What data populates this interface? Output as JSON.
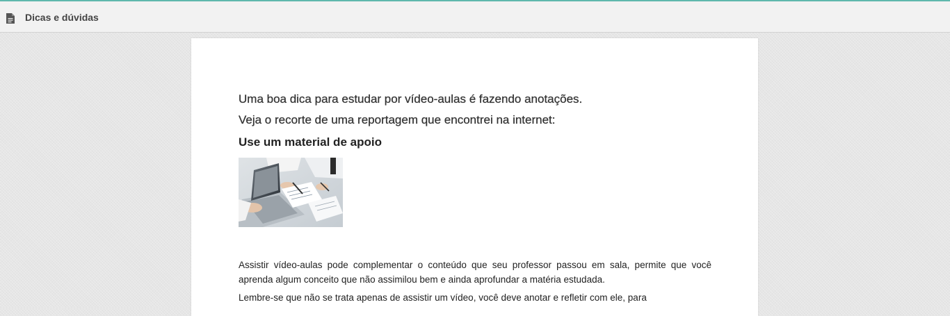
{
  "header": {
    "icon": "document-icon",
    "title": "Dicas e dúvidas",
    "accent_color": "#5fb8ad"
  },
  "article": {
    "line1": "Uma boa dica para estudar por vídeo-aulas é fazendo anotações.",
    "line2": "Veja o recorte de uma reportagem que encontrei na internet:",
    "subheading": "Use um material de apoio",
    "image_description": "laptop-and-notes-photo",
    "paragraph1": "Assistir vídeo-aulas pode complementar o conteúdo que seu professor passou em sala,  permite que você aprenda algum conceito que não assimilou bem e ainda aprofundar a matéria estudada.",
    "paragraph2": "Lembre-se que não se trata apenas de assistir um vídeo, você deve anotar e refletir com ele, para"
  }
}
